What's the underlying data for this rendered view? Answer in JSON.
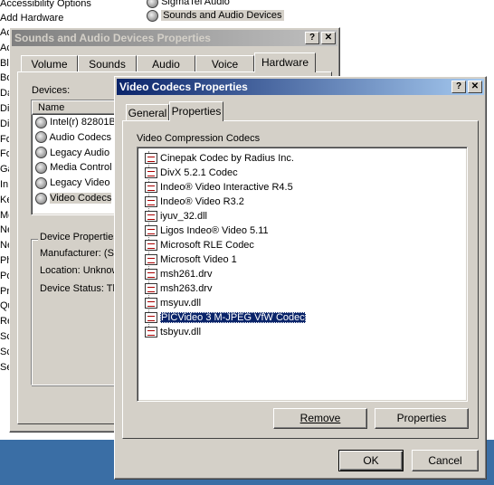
{
  "background": {
    "left_items": [
      "Accessibility Options",
      "Add Hardware",
      "Ac",
      "Ac",
      "Blu",
      "Bo",
      "Da",
      "Di",
      "Di",
      "Fo",
      "Fo",
      "Ga",
      "In",
      "Ke",
      "Mo",
      "Ne",
      "Ne",
      "Ph",
      "Po",
      "Pr",
      "Qu",
      "Re",
      "Sc",
      "Sc",
      "Se"
    ],
    "right_items": [
      "SigmaTel Audio",
      "Sounds and Audio Devices"
    ]
  },
  "sounds_dialog": {
    "title": "Sounds and Audio Devices Properties",
    "help_btn": "?",
    "close_btn": "✕",
    "tabs": [
      "Volume",
      "Sounds",
      "Audio",
      "Voice",
      "Hardware"
    ],
    "devices_label": "Devices:",
    "column_name": "Name",
    "devices": [
      "Intel(r) 82801B",
      "Audio Codecs",
      "Legacy Audio",
      "Media Control",
      "Legacy Video",
      "Video Codecs"
    ],
    "device_props_title": "Device Properties",
    "manufacturer": "Manufacturer: (St",
    "location": "Location: Unknow",
    "status": "Device Status: Th"
  },
  "codecs_dialog": {
    "title": "Video Codecs Properties",
    "help_btn": "?",
    "close_btn": "✕",
    "tabs": [
      "General",
      "Properties"
    ],
    "tree_title": "Video Compression Codecs",
    "codecs": [
      "Cinepak Codec by Radius Inc.",
      "DivX 5.2.1 Codec",
      "Indeo® Video Interactive R4.5",
      "Indeo® Video R3.2",
      "iyuv_32.dll",
      "Ligos Indeo® Video 5.11",
      "Microsoft RLE Codec",
      "Microsoft Video 1",
      "msh261.drv",
      "msh263.drv",
      "msyuv.dll",
      "PICVideo 3 M-JPEG VfW Codec",
      "tsbyuv.dll"
    ],
    "selected_index": 11,
    "remove_btn": "Remove",
    "properties_btn": "Properties",
    "ok_btn": "OK",
    "cancel_btn": "Cancel"
  },
  "colors": {
    "active_title": "#0a246a",
    "inactive_title": "#808080",
    "taskbar": "#3a6ea5",
    "button_face": "#d4d0c8"
  }
}
